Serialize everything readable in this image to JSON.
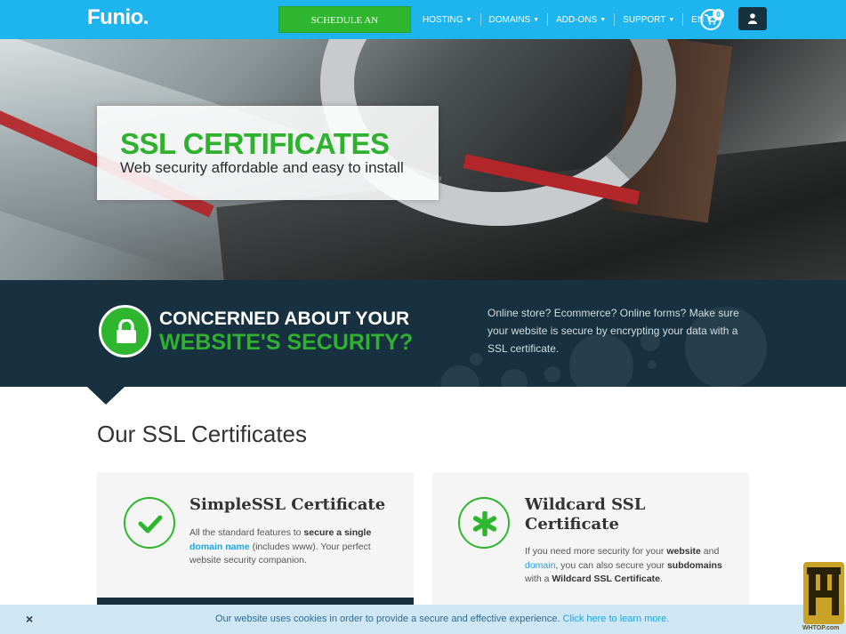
{
  "nav": {
    "logo": "Funio.",
    "appointment": "SCHEDULE AN APPOINTMENT",
    "links": [
      "HOSTING",
      "DOMAINS",
      "ADD-ONS",
      "SUPPORT",
      "EN"
    ],
    "cart_count": "0",
    "bg_color": "#1eb4ee"
  },
  "hero": {
    "title": "SSL CERTIFICATES",
    "subtitle": "Web security affordable and easy to install"
  },
  "band": {
    "line1": "CONCERNED ABOUT YOUR",
    "line2": "WEBSITE'S SECURITY?",
    "text": "Online store? Ecommerce? Online forms? Make sure your website is secure by encrypting your data with a SSL certificate."
  },
  "section": {
    "title": "Our SSL Certificates"
  },
  "cards": [
    {
      "title": "SimpleSSL Certificate",
      "desc_pre": "All the standard features to ",
      "desc_bold": "secure a single",
      "desc_link": "domain name",
      "desc_post": " (includes www). Your perfect website security companion.",
      "icon": "checkmark-icon"
    },
    {
      "title": "Wildcard SSL Certificate",
      "desc_pre": "If you need more security for your ",
      "desc_bold1": "website",
      "desc_mid1": " and ",
      "desc_link": "domain",
      "desc_mid2": ", you can also secure your ",
      "desc_bold2": "subdomains",
      "desc_mid3": " with a ",
      "desc_bold3": "Wildcard SSL Certificate",
      "desc_end": ".",
      "icon": "asterisk-icon"
    }
  ],
  "cookie": {
    "close": "×",
    "text": "Our website uses cookies in order to provide a secure and effective experience. ",
    "link": "Click here to learn more."
  },
  "watermark": {
    "text": "WHTOP.com"
  }
}
